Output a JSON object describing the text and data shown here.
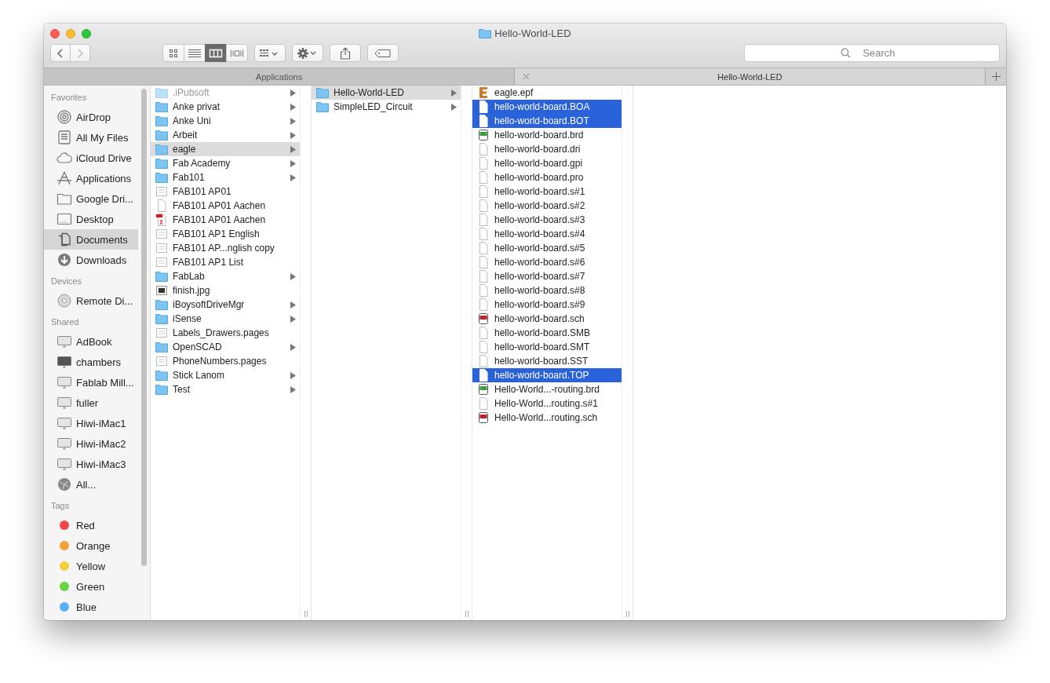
{
  "window": {
    "title": "Hello-World-LED"
  },
  "toolbar": {
    "view_modes": [
      {
        "kind": "icons",
        "selected": false
      },
      {
        "kind": "list",
        "selected": false
      },
      {
        "kind": "columns",
        "selected": true
      },
      {
        "kind": "coverflow",
        "selected": false
      }
    ]
  },
  "search": {
    "placeholder": "Search"
  },
  "tabs": [
    {
      "label": "Applications",
      "selected": false
    },
    {
      "label": "Hello-World-LED",
      "selected": true
    }
  ],
  "sidebar": {
    "sections": [
      {
        "title": "Favorites",
        "items": [
          {
            "label": "AirDrop",
            "kind": "airdrop",
            "selected": false
          },
          {
            "label": "All My Files",
            "kind": "allfiles",
            "selected": false
          },
          {
            "label": "iCloud Drive",
            "kind": "cloud",
            "selected": false
          },
          {
            "label": "Applications",
            "kind": "apps",
            "selected": false
          },
          {
            "label": "Google Dri...",
            "kind": "folder",
            "selected": false
          },
          {
            "label": "Desktop",
            "kind": "desktop",
            "selected": false
          },
          {
            "label": "Documents",
            "kind": "documents",
            "selected": true
          },
          {
            "label": "Downloads",
            "kind": "downloads",
            "selected": false
          }
        ]
      },
      {
        "title": "Devices",
        "items": [
          {
            "label": "Remote Di...",
            "kind": "disc",
            "selected": false
          }
        ]
      },
      {
        "title": "Shared",
        "items": [
          {
            "label": "AdBook",
            "kind": "monitor",
            "selected": false
          },
          {
            "label": "chambers",
            "kind": "imac",
            "selected": false
          },
          {
            "label": "Fablab Mill...",
            "kind": "monitor",
            "selected": false
          },
          {
            "label": "fuller",
            "kind": "monitor",
            "selected": false
          },
          {
            "label": "Hiwi-iMac1",
            "kind": "monitor",
            "selected": false
          },
          {
            "label": "Hiwi-iMac2",
            "kind": "monitor",
            "selected": false
          },
          {
            "label": "Hiwi-iMac3",
            "kind": "monitor",
            "selected": false
          },
          {
            "label": "All...",
            "kind": "network",
            "selected": false
          }
        ]
      },
      {
        "title": "Tags",
        "items": [
          {
            "label": "Red",
            "kind": "tag",
            "color": "#f5474b",
            "selected": false
          },
          {
            "label": "Orange",
            "kind": "tag",
            "color": "#f4a03b",
            "selected": false
          },
          {
            "label": "Yellow",
            "kind": "tag",
            "color": "#f4cf3c",
            "selected": false
          },
          {
            "label": "Green",
            "kind": "tag",
            "color": "#69d245",
            "selected": false
          },
          {
            "label": "Blue",
            "kind": "tag",
            "color": "#5bb1f8",
            "selected": false
          }
        ]
      }
    ]
  },
  "columns": [
    {
      "active": false,
      "items": [
        {
          "name": ".iPubsoft",
          "kind": "folder",
          "dimmed": true,
          "selected": false
        },
        {
          "name": "Anke privat",
          "kind": "folder",
          "dimmed": false,
          "selected": false
        },
        {
          "name": "Anke Uni",
          "kind": "folder",
          "dimmed": false,
          "selected": false
        },
        {
          "name": "Arbeit",
          "kind": "folder",
          "dimmed": false,
          "selected": false
        },
        {
          "name": "eagle",
          "kind": "folder",
          "dimmed": false,
          "selected": true
        },
        {
          "name": "Fab Academy",
          "kind": "folder",
          "dimmed": false,
          "selected": false
        },
        {
          "name": "Fab101",
          "kind": "folder",
          "dimmed": false,
          "selected": false
        },
        {
          "name": "FAB101 AP01",
          "kind": "doc",
          "dimmed": false,
          "selected": false
        },
        {
          "name": "FAB101 AP01 Aachen",
          "kind": "file",
          "dimmed": false,
          "selected": false
        },
        {
          "name": "FAB101 AP01 Aachen",
          "kind": "pdf",
          "dimmed": false,
          "selected": false
        },
        {
          "name": "FAB101 AP1 English",
          "kind": "doc",
          "dimmed": false,
          "selected": false
        },
        {
          "name": "FAB101 AP...nglish copy",
          "kind": "doc",
          "dimmed": false,
          "selected": false
        },
        {
          "name": "FAB101 AP1 List",
          "kind": "doc",
          "dimmed": false,
          "selected": false
        },
        {
          "name": "FabLab",
          "kind": "folder",
          "dimmed": false,
          "selected": false
        },
        {
          "name": "finish.jpg",
          "kind": "image",
          "dimmed": false,
          "selected": false
        },
        {
          "name": "iBoysoftDriveMgr",
          "kind": "folder",
          "dimmed": false,
          "selected": false
        },
        {
          "name": "iSense",
          "kind": "folder",
          "dimmed": false,
          "selected": false
        },
        {
          "name": "Labels_Drawers.pages",
          "kind": "doc",
          "dimmed": false,
          "selected": false
        },
        {
          "name": "OpenSCAD",
          "kind": "folder",
          "dimmed": false,
          "selected": false
        },
        {
          "name": "PhoneNumbers.pages",
          "kind": "doc",
          "dimmed": false,
          "selected": false
        },
        {
          "name": "Stick Lanom",
          "kind": "folder",
          "dimmed": false,
          "selected": false
        },
        {
          "name": "Test",
          "kind": "folder",
          "dimmed": false,
          "selected": false
        }
      ]
    },
    {
      "active": false,
      "items": [
        {
          "name": "Hello-World-LED",
          "kind": "folder",
          "dimmed": false,
          "selected": true
        },
        {
          "name": "SimpleLED_Circuit",
          "kind": "folder",
          "dimmed": false,
          "selected": false
        }
      ]
    },
    {
      "active": true,
      "items": [
        {
          "name": "eagle.epf",
          "kind": "eagle",
          "dimmed": false,
          "selected": false
        },
        {
          "name": "hello-world-board.BOA",
          "kind": "file",
          "dimmed": false,
          "selected": true
        },
        {
          "name": "hello-world-board.BOT",
          "kind": "file",
          "dimmed": false,
          "selected": true
        },
        {
          "name": "hello-world-board.brd",
          "kind": "brd",
          "dimmed": false,
          "selected": false
        },
        {
          "name": "hello-world-board.dri",
          "kind": "file",
          "dimmed": false,
          "selected": false
        },
        {
          "name": "hello-world-board.gpi",
          "kind": "file",
          "dimmed": false,
          "selected": false
        },
        {
          "name": "hello-world-board.pro",
          "kind": "file",
          "dimmed": false,
          "selected": false
        },
        {
          "name": "hello-world-board.s#1",
          "kind": "file",
          "dimmed": false,
          "selected": false
        },
        {
          "name": "hello-world-board.s#2",
          "kind": "file",
          "dimmed": false,
          "selected": false
        },
        {
          "name": "hello-world-board.s#3",
          "kind": "file",
          "dimmed": false,
          "selected": false
        },
        {
          "name": "hello-world-board.s#4",
          "kind": "file",
          "dimmed": false,
          "selected": false
        },
        {
          "name": "hello-world-board.s#5",
          "kind": "file",
          "dimmed": false,
          "selected": false
        },
        {
          "name": "hello-world-board.s#6",
          "kind": "file",
          "dimmed": false,
          "selected": false
        },
        {
          "name": "hello-world-board.s#7",
          "kind": "file",
          "dimmed": false,
          "selected": false
        },
        {
          "name": "hello-world-board.s#8",
          "kind": "file",
          "dimmed": false,
          "selected": false
        },
        {
          "name": "hello-world-board.s#9",
          "kind": "file",
          "dimmed": false,
          "selected": false
        },
        {
          "name": "hello-world-board.sch",
          "kind": "sch",
          "dimmed": false,
          "selected": false
        },
        {
          "name": "hello-world-board.SMB",
          "kind": "file",
          "dimmed": false,
          "selected": false
        },
        {
          "name": "hello-world-board.SMT",
          "kind": "file",
          "dimmed": false,
          "selected": false
        },
        {
          "name": "hello-world-board.SST",
          "kind": "file",
          "dimmed": false,
          "selected": false
        },
        {
          "name": "hello-world-board.TOP",
          "kind": "file",
          "dimmed": false,
          "selected": true
        },
        {
          "name": "Hello-World...-routing.brd",
          "kind": "brd",
          "dimmed": false,
          "selected": false
        },
        {
          "name": "Hello-World...routing.s#1",
          "kind": "file",
          "dimmed": false,
          "selected": false
        },
        {
          "name": "Hello-World...routing.sch",
          "kind": "sch",
          "dimmed": false,
          "selected": false
        }
      ]
    }
  ]
}
